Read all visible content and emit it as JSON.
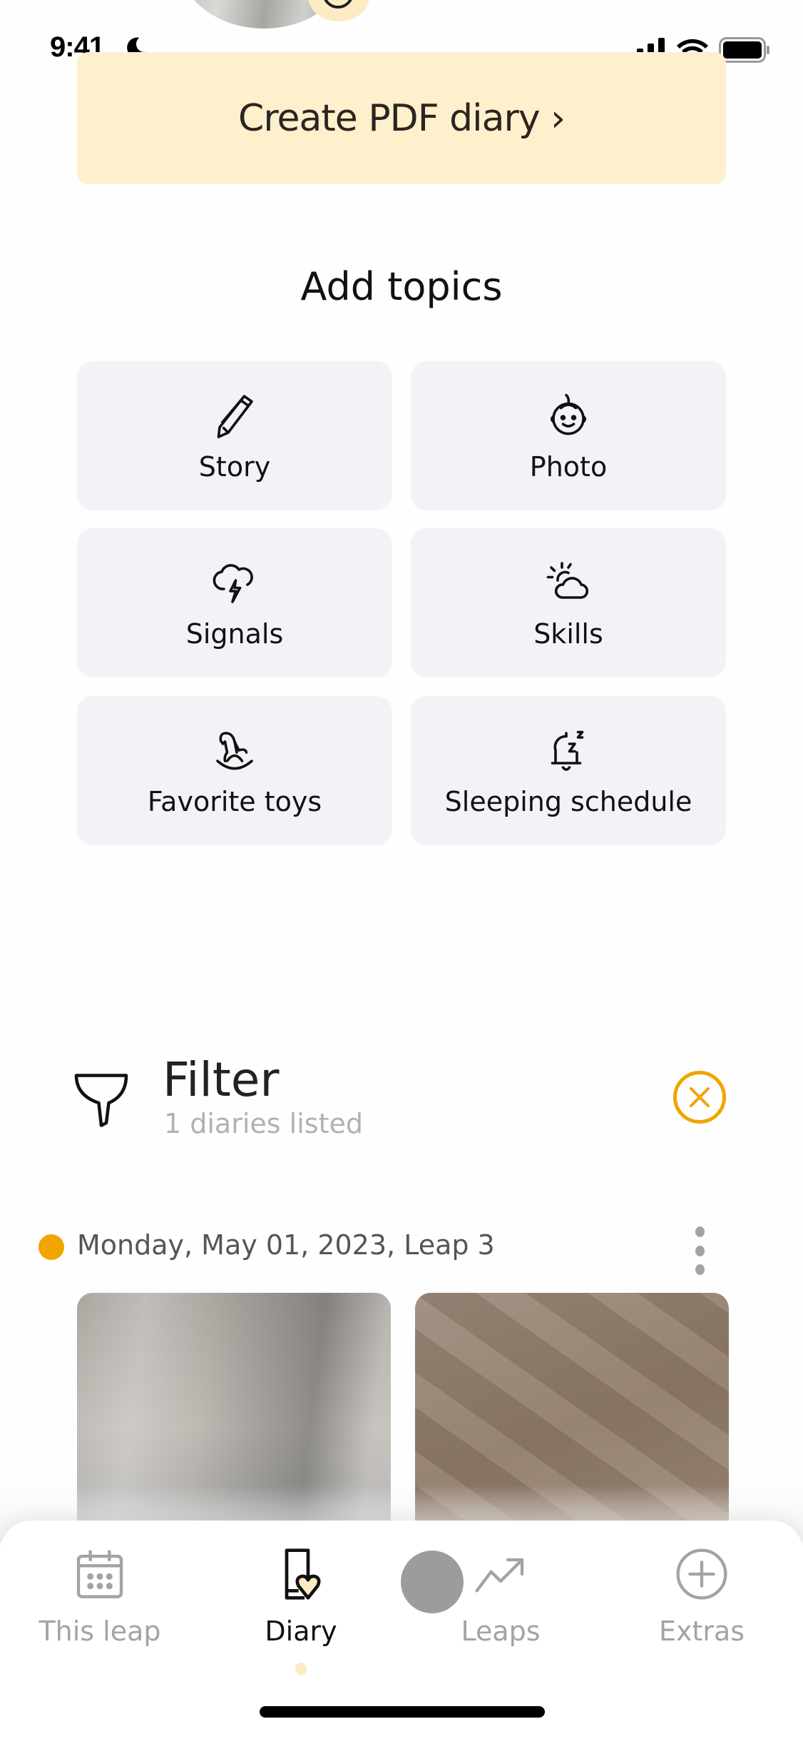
{
  "status_bar": {
    "time": "9:41",
    "focus_icon": "moon-icon",
    "icons": [
      "cellular-signal-icon",
      "wifi-icon",
      "battery-icon"
    ]
  },
  "header": {
    "avatar": "baby-avatar",
    "avatar_badge_icon": "edit-photo-icon"
  },
  "pdf_button": {
    "label": "Create PDF diary ›"
  },
  "add_topics": {
    "title": "Add topics",
    "items": [
      {
        "label": "Story",
        "icon": "pencil-icon"
      },
      {
        "label": "Photo",
        "icon": "baby-face-icon"
      },
      {
        "label": "Signals",
        "icon": "storm-cloud-icon"
      },
      {
        "label": "Skills",
        "icon": "sun-cloud-icon"
      },
      {
        "label": "Favorite toys",
        "icon": "rocking-horse-icon"
      },
      {
        "label": "Sleeping schedule",
        "icon": "bell-sleep-icon"
      }
    ]
  },
  "filter": {
    "title": "Filter",
    "subtitle": "1 diaries listed",
    "clear_icon": "close-circle-icon",
    "accent_color": "#F0A500"
  },
  "entries": [
    {
      "date": "Monday, May 01, 2023, Leap 3",
      "dot_color": "#F0A500",
      "photos": [
        "photo-thumbnail-1",
        "photo-thumbnail-2"
      ]
    }
  ],
  "bottom_nav": {
    "tabs": [
      {
        "label": "This leap",
        "icon": "calendar-icon",
        "active": false
      },
      {
        "label": "Diary",
        "icon": "diary-heart-icon",
        "active": true
      },
      {
        "label": "Leaps",
        "icon": "trending-up-icon",
        "active": false
      },
      {
        "label": "Extras",
        "icon": "plus-circle-icon",
        "active": false
      }
    ]
  }
}
